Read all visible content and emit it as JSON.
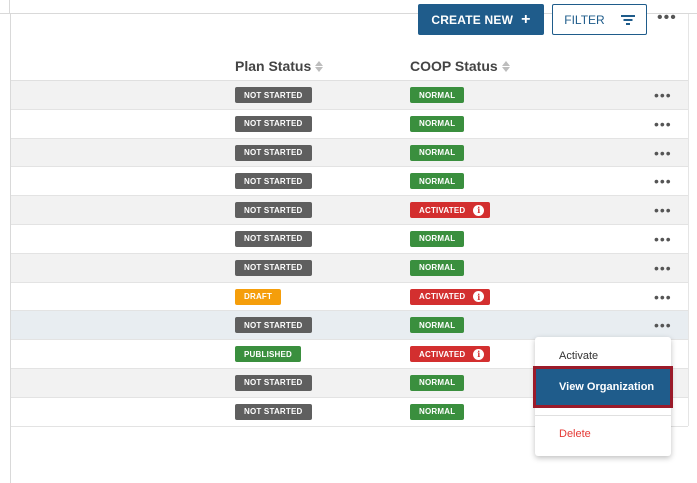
{
  "toolbar": {
    "create_label": "CREATE NEW",
    "create_icon": "+",
    "filter_label": "FILTER",
    "more_label": "•••"
  },
  "table": {
    "columns": [
      "Plan Status",
      "COOP Status"
    ],
    "rows": [
      {
        "plan": "NOT STARTED",
        "coop": "NORMAL"
      },
      {
        "plan": "NOT STARTED",
        "coop": "NORMAL"
      },
      {
        "plan": "NOT STARTED",
        "coop": "NORMAL"
      },
      {
        "plan": "NOT STARTED",
        "coop": "NORMAL"
      },
      {
        "plan": "NOT STARTED",
        "coop": "ACTIVATED"
      },
      {
        "plan": "NOT STARTED",
        "coop": "NORMAL"
      },
      {
        "plan": "NOT STARTED",
        "coop": "NORMAL"
      },
      {
        "plan": "DRAFT",
        "coop": "ACTIVATED"
      },
      {
        "plan": "NOT STARTED",
        "coop": "NORMAL"
      },
      {
        "plan": "PUBLISHED",
        "coop": "ACTIVATED"
      },
      {
        "plan": "NOT STARTED",
        "coop": "NORMAL"
      },
      {
        "plan": "NOT STARTED",
        "coop": "NORMAL"
      }
    ],
    "row_more_label": "•••",
    "info_icon_glyph": "i"
  },
  "context_menu": {
    "items": [
      "Activate",
      "View Organization",
      "Delete"
    ]
  },
  "colors": {
    "primary": "#1f5c8b",
    "not_started": "#5f5f5f",
    "normal": "#3a8f3e",
    "activated": "#d32f2f",
    "draft": "#f59e0b",
    "published": "#3a8f3e",
    "delete": "#e53935",
    "highlight_outline": "#9b1b2a"
  }
}
